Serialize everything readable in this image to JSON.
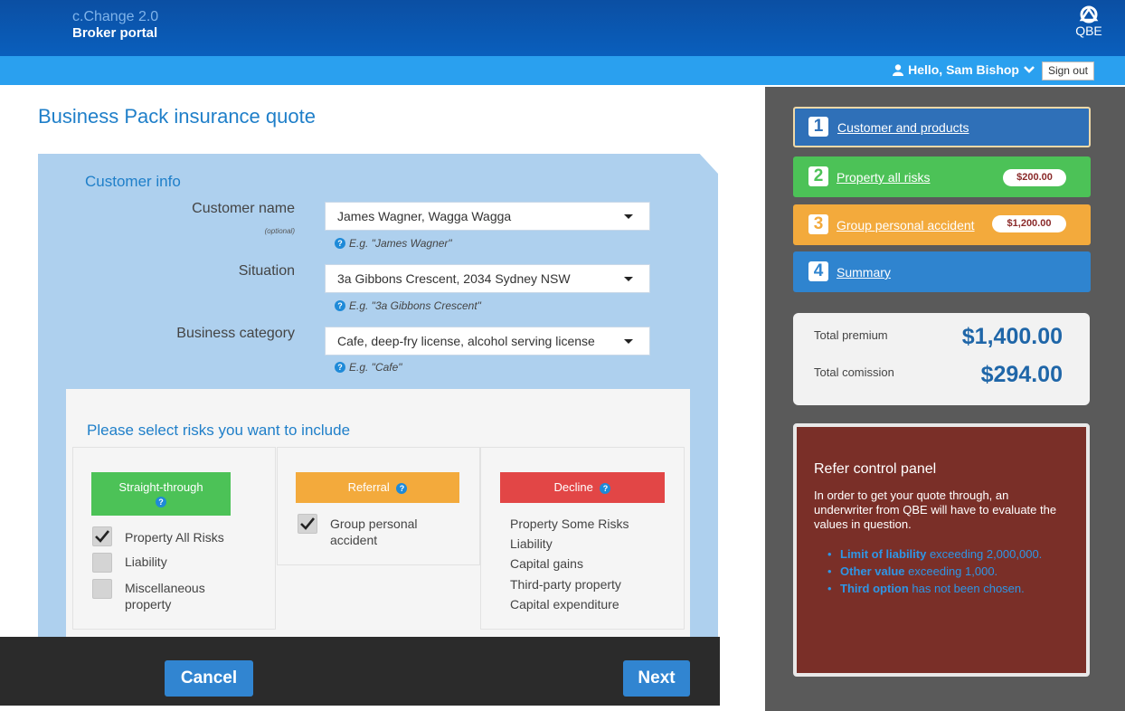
{
  "header": {
    "app_title": "c.Change 2.0",
    "app_subtitle": "Broker portal",
    "logo_text": "QBE",
    "greeting": "Hello, Sam Bishop",
    "sign_out": "Sign out"
  },
  "page": {
    "title": "Business Pack insurance quote"
  },
  "customer_info": {
    "title": "Customer info",
    "fields": [
      {
        "label": "Customer name",
        "sublabel": "(optional)",
        "value": "James Wagner, Wagga Wagga",
        "hint": "E.g. \"James Wagner\""
      },
      {
        "label": "Situation",
        "value": "3a Gibbons Crescent, 2034 Sydney NSW",
        "hint": "E.g. \"3a Gibbons Crescent\""
      },
      {
        "label": "Business category",
        "value": "Cafe, deep-fry license, alcohol serving license",
        "hint": "E.g. \"Cafe\""
      }
    ]
  },
  "risks": {
    "title": "Please select risks you want to include",
    "straight_through": {
      "label": "Straight-through",
      "items": [
        {
          "label": "Property All Risks",
          "checked": true
        },
        {
          "label": "Liability",
          "checked": false
        },
        {
          "label": "Miscellaneous property",
          "checked": false
        }
      ]
    },
    "referral": {
      "label": "Referral",
      "items": [
        {
          "label": "Group personal accident",
          "checked": true
        }
      ]
    },
    "decline": {
      "label": "Decline",
      "items": [
        "Property Some Risks",
        "Liability",
        "Capital gains",
        "Third-party property",
        "Capital expenditure"
      ]
    }
  },
  "footer": {
    "cancel": "Cancel",
    "next": "Next"
  },
  "steps": [
    {
      "num": "1",
      "label": "Customer and products",
      "color": "#2f70b8"
    },
    {
      "num": "2",
      "label": "Property all risks",
      "price": "$200.00",
      "color": "#4cc257"
    },
    {
      "num": "3",
      "label": "Group personal accident",
      "price": "$1,200.00",
      "color": "#f3aa3c"
    },
    {
      "num": "4",
      "label": "Summary",
      "color": "#2f84cf"
    }
  ],
  "totals": {
    "premium_label": "Total premium",
    "premium_value": "$1,400.00",
    "commission_label": "Total comission",
    "commission_value": "$294.00"
  },
  "refer_panel": {
    "title": "Refer control panel",
    "text": "In order to get your quote through, an underwriter from QBE will have to evaluate the values in question.",
    "items": [
      {
        "bold": "Limit of liability",
        "rest": " exceeding 2,000,000."
      },
      {
        "bold": "Other value",
        "rest": " exceeding 1,000."
      },
      {
        "bold": "Third option",
        "rest": " has not been chosen."
      }
    ]
  },
  "colors": {
    "header_dark": "#0b4fa3",
    "header_light": "#2aa0ef",
    "accent_blue": "#1f7fc9",
    "straight_through": "#4cc257",
    "referral": "#f3aa3c",
    "decline": "#e24646"
  }
}
